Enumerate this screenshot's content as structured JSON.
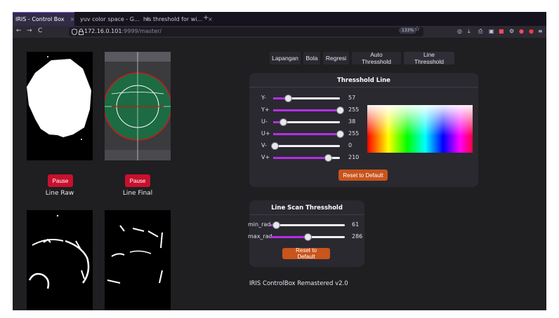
{
  "browser": {
    "tabs": [
      {
        "title": "IRIS - Control Box",
        "close": "×"
      },
      {
        "title": "yuv color space - G...",
        "close": "×"
      },
      {
        "title": "hls threshold for wi...",
        "close": "×"
      }
    ],
    "new_tab": "+",
    "nav": {
      "back": "←",
      "forward": "→",
      "reload": "C"
    },
    "url_host": "172.16.0.101",
    "url_rest": ":9999/master/",
    "zoom": "133%",
    "bookmark": "☆",
    "toolbar_icons": [
      "pocket-icon",
      "download-icon",
      "print-icon",
      "screenshot-icon",
      "extension-red-icon",
      "extension-icon",
      "extension-red2-icon",
      "extension-red3-icon",
      "menu-icon"
    ]
  },
  "cameras": [
    {
      "label": "Line Raw",
      "pause": "Pause"
    },
    {
      "label": "Line Final",
      "pause": "Pause"
    }
  ],
  "tab_buttons": [
    "Lapangan",
    "Bola",
    "Regresi",
    "Auto Thresshold",
    "Line Thresshold"
  ],
  "threshold_line": {
    "title": "Thresshold Line",
    "sliders": [
      {
        "label": "Y-",
        "value": "57",
        "fraction": 0.22
      },
      {
        "label": "Y+",
        "value": "255",
        "fraction": 1.0
      },
      {
        "label": "U-",
        "value": "38",
        "fraction": 0.15
      },
      {
        "label": "U+",
        "value": "255",
        "fraction": 1.0
      },
      {
        "label": "V-",
        "value": "0",
        "fraction": 0.0
      },
      {
        "label": "V+",
        "value": "210",
        "fraction": 0.82
      }
    ],
    "reset": "Reset to Default"
  },
  "line_scan": {
    "title": "Line Scan Thresshold",
    "sliders": [
      {
        "label": "min_rad",
        "value": "61",
        "fraction": 0.08
      },
      {
        "label": "max_rad",
        "value": "286",
        "fraction": 0.5
      }
    ],
    "reset": "Reset to Default"
  },
  "footer": "IRIS ControlBox Remastered v2.0"
}
